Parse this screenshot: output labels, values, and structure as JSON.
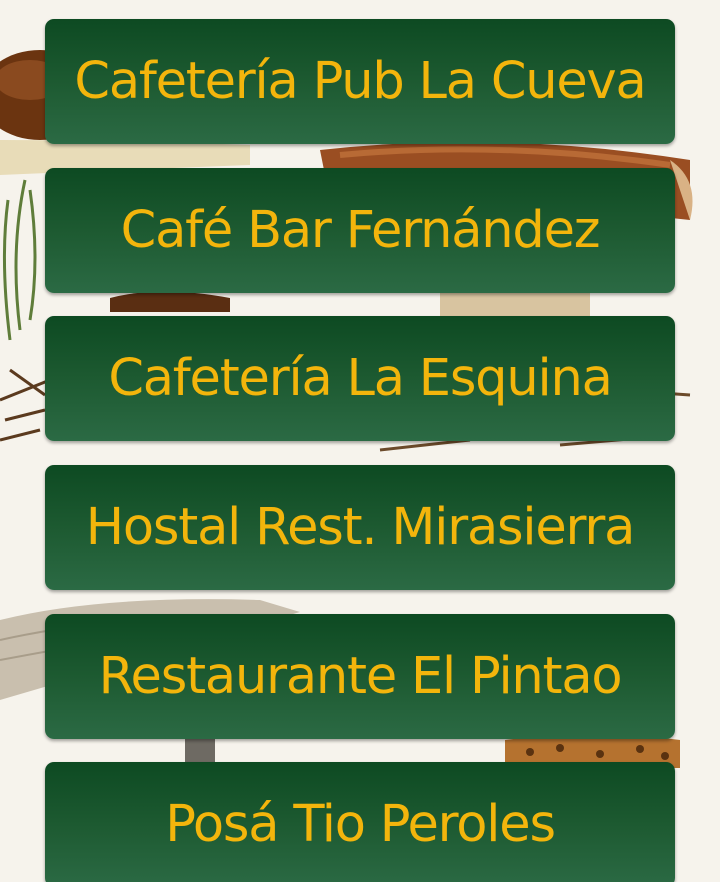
{
  "venues": [
    {
      "label": "Cafetería Pub La Cueva"
    },
    {
      "label": "Café Bar Fernández"
    },
    {
      "label": "Cafetería La Esquina"
    },
    {
      "label": "Hostal Rest. Mirasierra"
    },
    {
      "label": "Restaurante El Pintao"
    },
    {
      "label": "Posá Tio Peroles"
    }
  ],
  "background": {
    "icon": "mushroom-illustration",
    "colors": {
      "page": "#f6f3ec",
      "cap_brown": "#7a3b14",
      "cap_orange": "#b4632b",
      "stem": "#e6d9b3",
      "grass": "#5f7d3a"
    }
  },
  "colors": {
    "button_top": "#0d4a22",
    "button_bottom": "#2b6a44",
    "label": "#f3b50c"
  }
}
